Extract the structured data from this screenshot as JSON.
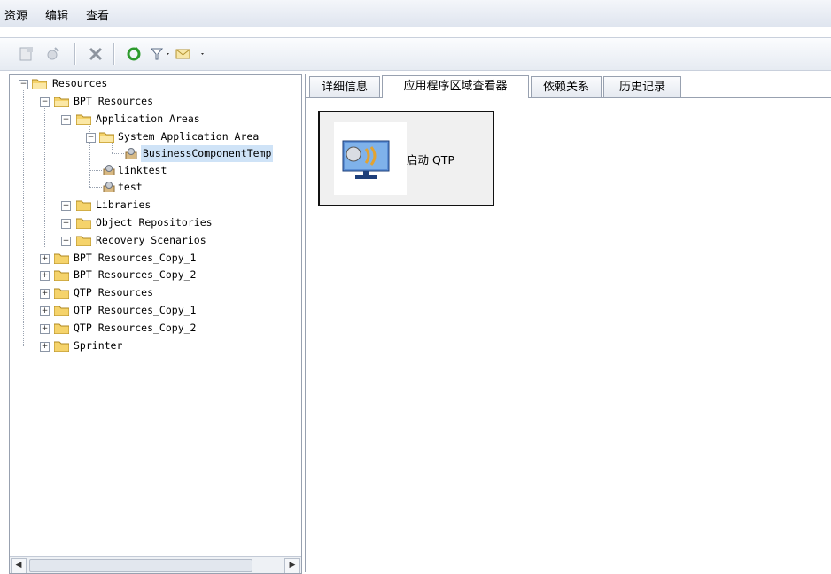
{
  "menu": {
    "items": [
      "资源",
      "编辑",
      "查看"
    ]
  },
  "toolbar": {
    "icons": [
      "new-resource-icon",
      "import-icon",
      "delete-icon",
      "refresh-icon",
      "filter-icon",
      "send-mail-icon"
    ]
  },
  "tree": {
    "root": "Resources",
    "bpt": "BPT Resources",
    "app_areas": "Application Areas",
    "system_area": "System Application Area",
    "business_comp": "BusinessComponentTemp",
    "linktest": "linktest",
    "test": "test",
    "libraries": "Libraries",
    "object_repos": "Object Repositories",
    "recovery": "Recovery Scenarios",
    "bpt_copy1": "BPT Resources_Copy_1",
    "bpt_copy2": "BPT Resources_Copy_2",
    "qtp": "QTP Resources",
    "qtp_copy1": "QTP Resources_Copy_1",
    "qtp_copy2": "QTP Resources_Copy_2",
    "sprinter": "Sprinter"
  },
  "tabs": [
    "详细信息",
    "应用程序区域查看器",
    "依赖关系",
    "历史记录"
  ],
  "active_tab": "应用程序区域查看器",
  "viewer": {
    "launch_label": "启动 QTP"
  },
  "colors": {
    "selection": "#cfe3f7",
    "folder": "#f5d36b"
  }
}
